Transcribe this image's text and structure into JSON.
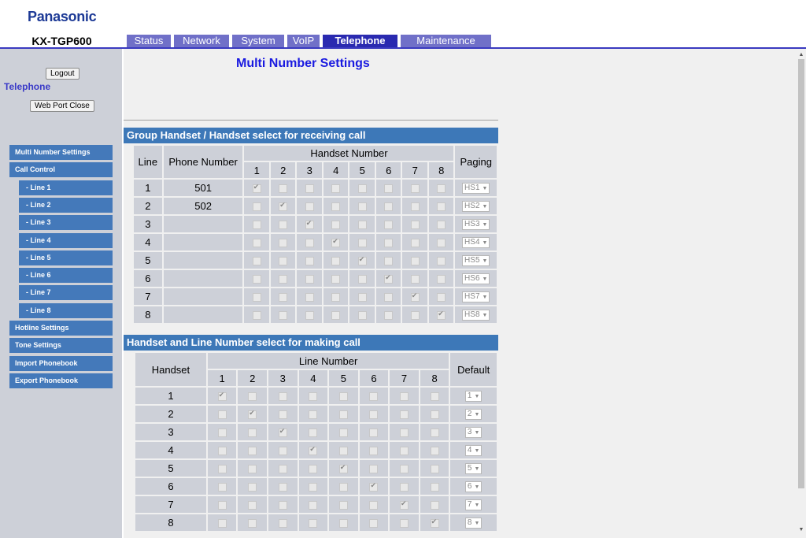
{
  "header": {
    "brand": "Panasonic",
    "model": "KX-TGP600"
  },
  "tabs": [
    {
      "label": "Status",
      "active": false
    },
    {
      "label": "Network",
      "active": false
    },
    {
      "label": "System",
      "active": false
    },
    {
      "label": "VoIP",
      "active": false
    },
    {
      "label": "Telephone",
      "active": true
    },
    {
      "label": "Maintenance",
      "active": false
    }
  ],
  "sidebar": {
    "logout": "Logout",
    "web_port_close": "Web Port Close",
    "section": "Telephone",
    "items": [
      {
        "label": "Multi Number Settings",
        "indent": false
      },
      {
        "label": "Call Control",
        "indent": false
      },
      {
        "label": "- Line 1",
        "indent": true
      },
      {
        "label": "- Line 2",
        "indent": true
      },
      {
        "label": "- Line 3",
        "indent": true
      },
      {
        "label": "- Line 4",
        "indent": true
      },
      {
        "label": "- Line 5",
        "indent": true
      },
      {
        "label": "- Line 6",
        "indent": true
      },
      {
        "label": "- Line 7",
        "indent": true
      },
      {
        "label": "- Line 8",
        "indent": true
      },
      {
        "label": "Hotline Settings",
        "indent": false
      },
      {
        "label": "Tone Settings",
        "indent": false
      },
      {
        "label": "Import Phonebook",
        "indent": false
      },
      {
        "label": "Export Phonebook",
        "indent": false
      }
    ]
  },
  "main": {
    "title": "Multi Number Settings",
    "receiving": {
      "heading": "Group Handset / Handset select for receiving call",
      "col_line": "Line",
      "col_phone": "Phone Number",
      "col_handset_group": "Handset Number",
      "col_paging": "Paging",
      "handset_cols": [
        "1",
        "2",
        "3",
        "4",
        "5",
        "6",
        "7",
        "8"
      ],
      "rows": [
        {
          "line": "1",
          "phone": "501",
          "checked": [
            1
          ],
          "paging": "HS1"
        },
        {
          "line": "2",
          "phone": "502",
          "checked": [
            2
          ],
          "paging": "HS2"
        },
        {
          "line": "3",
          "phone": "",
          "checked": [
            3
          ],
          "paging": "HS3"
        },
        {
          "line": "4",
          "phone": "",
          "checked": [
            4
          ],
          "paging": "HS4"
        },
        {
          "line": "5",
          "phone": "",
          "checked": [
            5
          ],
          "paging": "HS5"
        },
        {
          "line": "6",
          "phone": "",
          "checked": [
            6
          ],
          "paging": "HS6"
        },
        {
          "line": "7",
          "phone": "",
          "checked": [
            7
          ],
          "paging": "HS7"
        },
        {
          "line": "8",
          "phone": "",
          "checked": [
            8
          ],
          "paging": "HS8"
        }
      ]
    },
    "making": {
      "heading": "Handset and Line Number select for making call",
      "col_handset": "Handset",
      "col_line_group": "Line Number",
      "col_default": "Default",
      "line_cols": [
        "1",
        "2",
        "3",
        "4",
        "5",
        "6",
        "7",
        "8"
      ],
      "rows": [
        {
          "handset": "1",
          "checked": [
            1
          ],
          "default": "1"
        },
        {
          "handset": "2",
          "checked": [
            2
          ],
          "default": "2"
        },
        {
          "handset": "3",
          "checked": [
            3
          ],
          "default": "3"
        },
        {
          "handset": "4",
          "checked": [
            4
          ],
          "default": "4"
        },
        {
          "handset": "5",
          "checked": [
            5
          ],
          "default": "5"
        },
        {
          "handset": "6",
          "checked": [
            6
          ],
          "default": "6"
        },
        {
          "handset": "7",
          "checked": [
            7
          ],
          "default": "7"
        },
        {
          "handset": "8",
          "checked": [
            8
          ],
          "default": "8"
        }
      ]
    }
  },
  "icons": {
    "select_arrow": "▼",
    "scroll_up": "▲",
    "scroll_down": "▼"
  }
}
